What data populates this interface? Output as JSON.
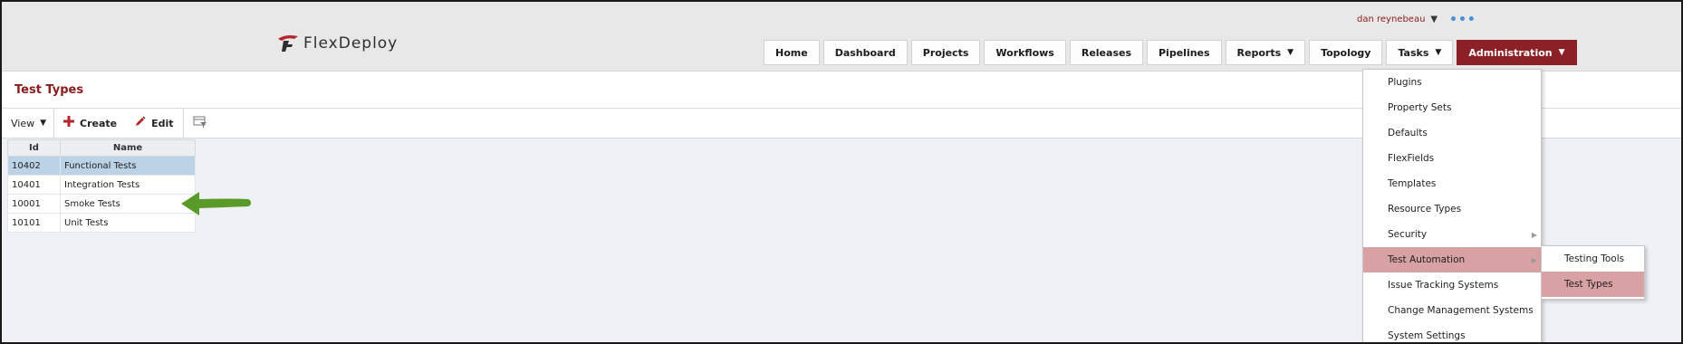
{
  "header": {
    "logo_text": "FlexDeploy",
    "user_name": "dan reynebeau",
    "user_caret": "▼",
    "more_dots": "•••"
  },
  "nav": [
    {
      "label": "Home",
      "caret": ""
    },
    {
      "label": "Dashboard",
      "caret": ""
    },
    {
      "label": "Projects",
      "caret": ""
    },
    {
      "label": "Workflows",
      "caret": ""
    },
    {
      "label": "Releases",
      "caret": ""
    },
    {
      "label": "Pipelines",
      "caret": ""
    },
    {
      "label": "Reports",
      "caret": "▼"
    },
    {
      "label": "Topology",
      "caret": ""
    },
    {
      "label": "Tasks",
      "caret": "▼"
    },
    {
      "label": "Administration",
      "caret": "▼"
    }
  ],
  "page": {
    "title": "Test Types"
  },
  "toolbar": {
    "view_label": "View",
    "view_caret": "▼",
    "create_label": "Create",
    "edit_label": "Edit"
  },
  "table": {
    "columns": [
      "Id",
      "Name"
    ],
    "rows": [
      {
        "id": "10402",
        "name": "Functional Tests",
        "selected": true
      },
      {
        "id": "10401",
        "name": "Integration Tests",
        "selected": false
      },
      {
        "id": "10001",
        "name": "Smoke Tests",
        "selected": false
      },
      {
        "id": "10101",
        "name": "Unit Tests",
        "selected": false
      }
    ]
  },
  "admin_menu": {
    "items": [
      {
        "label": "Plugins"
      },
      {
        "label": "Property Sets"
      },
      {
        "label": "Defaults"
      },
      {
        "label": "FlexFields"
      },
      {
        "label": "Templates"
      },
      {
        "label": "Resource Types"
      },
      {
        "label": "Security"
      },
      {
        "label": "Test Automation"
      },
      {
        "label": "Issue Tracking Systems"
      },
      {
        "label": "Change Management Systems"
      },
      {
        "label": "System Settings"
      }
    ],
    "submenu": [
      {
        "label": "Testing Tools"
      },
      {
        "label": "Test Types"
      }
    ]
  },
  "colors": {
    "brand": "#8c2027",
    "menu_highlight": "#d8a1a3",
    "row_selected": "#bcd2e6",
    "arrow": "#5a9a2a"
  }
}
